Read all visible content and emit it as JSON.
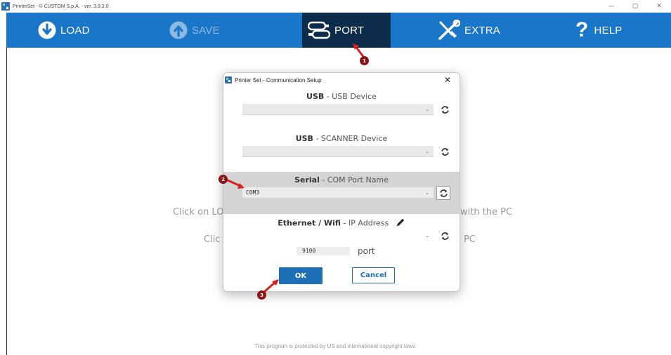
{
  "window": {
    "title": "PrinterSet - © CUSTOM S.p.A. - ver. 3.9.2.0",
    "controls": {
      "minimize": "—",
      "maximize": "▢",
      "close": "✕"
    }
  },
  "toolbar": {
    "load": "LOAD",
    "save": "SAVE",
    "port": "PORT",
    "extra": "EXTRA",
    "help": "HELP",
    "accent_color": "#1976c8",
    "active_color": "#0d2b4a"
  },
  "background": {
    "line1_left": "Click on LO",
    "line1_right": "with the PC",
    "line2_left": "Clic",
    "line2_right": "PC",
    "copyright": "This program is protected by US and international copyright laws."
  },
  "dialog": {
    "title": "Printer Set - Communication Setup",
    "close": "✕",
    "usb": {
      "bold": "USB",
      "rest": " - USB Device",
      "value": ""
    },
    "scanner": {
      "bold": "USB",
      "rest": " - SCANNER Device",
      "value": ""
    },
    "serial": {
      "bold": "Serial",
      "rest": " - COM Port Name",
      "value": "COM3"
    },
    "ethernet": {
      "bold": "Ethernet / Wifi",
      "rest": " - IP Address",
      "value": ""
    },
    "port_value": "9100",
    "port_label": "port",
    "ok": "OK",
    "cancel": "Cancel",
    "chevron": "⌄"
  },
  "callouts": {
    "one": "1",
    "two": "2",
    "three": "3"
  }
}
